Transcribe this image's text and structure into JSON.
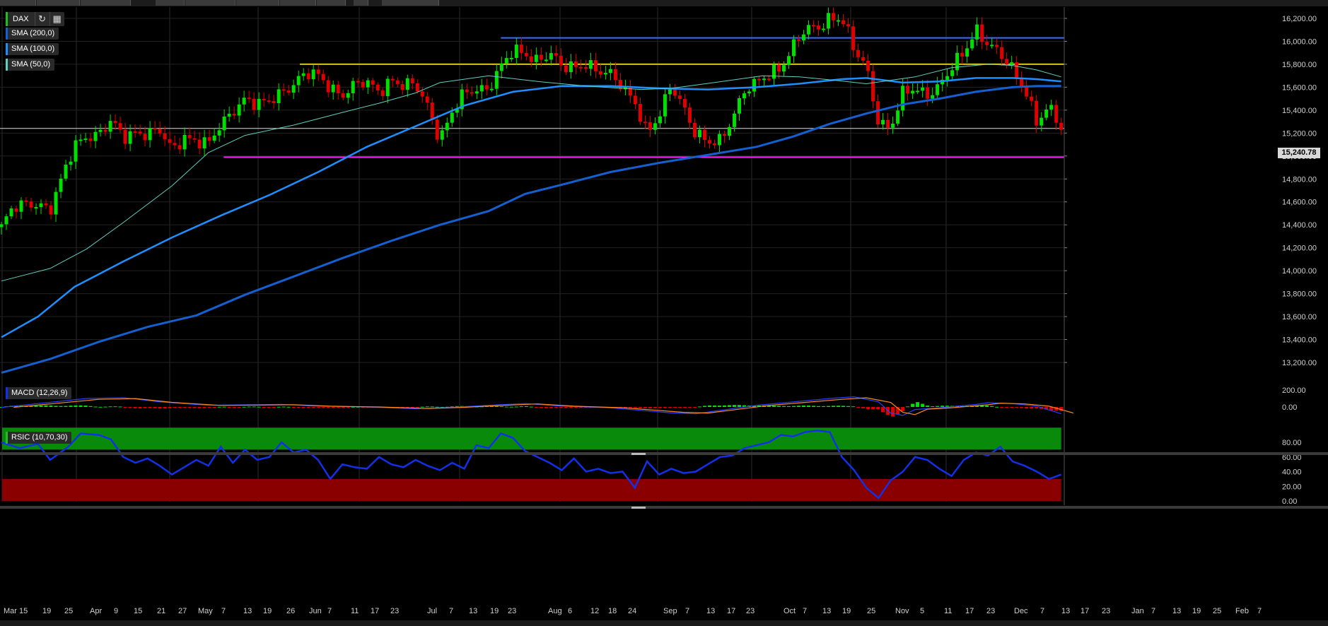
{
  "instrument": "DAX",
  "current_price_label": "15,240.78",
  "indicators": {
    "sma200": "SMA (200,0)",
    "sma100": "SMA (100,0)",
    "sma50": "SMA (50,0)",
    "macd": "MACD (12,26,9)",
    "rsic": "RSIC (10,70,30)"
  },
  "icons": {
    "refresh": "refresh-icon",
    "calendar": "calendar-icon"
  },
  "colors": {
    "up": "#00e000",
    "down": "#e00000",
    "sma50": "#5fd0c0",
    "sma100": "#1e8fff",
    "sma200": "#1560d0",
    "resistance_blue": "#3a6bff",
    "resistance_yellow": "#d7c41c",
    "support_magenta": "#ff20ff",
    "rsi_overbought_zone": "#0a8a0a",
    "rsi_oversold_zone": "#8a0000",
    "rsi_line": "#1230e8"
  },
  "chart_data": {
    "type": "candlestick",
    "price_axis": {
      "ylim": [
        13100,
        16300
      ],
      "ticks": [
        "16,200.00",
        "16,000.00",
        "15,800.00",
        "15,600.00",
        "15,400.00",
        "15,200.00",
        "15,000.00",
        "14,800.00",
        "14,600.00",
        "14,400.00",
        "14,200.00",
        "14,000.00",
        "13,800.00",
        "13,600.00",
        "13,400.00",
        "13,200.00"
      ]
    },
    "x_ticks": [
      "Mar 15",
      "19",
      "25",
      "Apr",
      "9",
      "15",
      "21",
      "27",
      "May",
      "7",
      "13",
      "19",
      "26",
      "Jun",
      "7",
      "11",
      "17",
      "23",
      "Jul",
      "7",
      "13",
      "19",
      "23",
      "Aug",
      "6",
      "12",
      "18",
      "24",
      "Sep",
      "7",
      "13",
      "17",
      "23",
      "Oct",
      "7",
      "13",
      "19",
      "25",
      "Nov",
      "5",
      "11",
      "17",
      "23",
      "Dec",
      "7",
      "13",
      "17",
      "23",
      "Jan",
      "7",
      "13",
      "19",
      "25",
      "Feb",
      "7"
    ],
    "horizontal_lines": [
      {
        "level": 16030,
        "color": "blue"
      },
      {
        "level": 15800,
        "color": "yellow"
      },
      {
        "level": 14990,
        "color": "magenta"
      },
      {
        "level": 15240.78,
        "color": "white"
      }
    ],
    "sma50_anchors": [
      [
        0,
        13910
      ],
      [
        80,
        14020
      ],
      [
        140,
        14190
      ],
      [
        200,
        14420
      ],
      [
        280,
        14740
      ],
      [
        340,
        15030
      ],
      [
        400,
        15180
      ],
      [
        480,
        15270
      ],
      [
        560,
        15380
      ],
      [
        620,
        15460
      ],
      [
        680,
        15550
      ],
      [
        720,
        15640
      ],
      [
        800,
        15700
      ],
      [
        880,
        15650
      ],
      [
        960,
        15610
      ],
      [
        1050,
        15580
      ],
      [
        1100,
        15590
      ],
      [
        1170,
        15640
      ],
      [
        1250,
        15700
      ],
      [
        1310,
        15690
      ],
      [
        1370,
        15660
      ],
      [
        1420,
        15630
      ],
      [
        1500,
        15690
      ],
      [
        1560,
        15770
      ],
      [
        1620,
        15800
      ],
      [
        1660,
        15790
      ],
      [
        1700,
        15750
      ],
      [
        1740,
        15690
      ]
    ],
    "sma100_anchors": [
      [
        0,
        13420
      ],
      [
        60,
        13600
      ],
      [
        120,
        13860
      ],
      [
        200,
        14080
      ],
      [
        280,
        14290
      ],
      [
        360,
        14480
      ],
      [
        440,
        14660
      ],
      [
        520,
        14860
      ],
      [
        600,
        15080
      ],
      [
        680,
        15260
      ],
      [
        760,
        15440
      ],
      [
        840,
        15560
      ],
      [
        920,
        15610
      ],
      [
        1000,
        15610
      ],
      [
        1080,
        15590
      ],
      [
        1160,
        15580
      ],
      [
        1240,
        15600
      ],
      [
        1310,
        15630
      ],
      [
        1380,
        15670
      ],
      [
        1420,
        15680
      ],
      [
        1480,
        15640
      ],
      [
        1540,
        15650
      ],
      [
        1600,
        15680
      ],
      [
        1660,
        15680
      ],
      [
        1700,
        15670
      ],
      [
        1740,
        15650
      ]
    ],
    "sma200_anchors": [
      [
        0,
        13110
      ],
      [
        80,
        13230
      ],
      [
        160,
        13380
      ],
      [
        240,
        13510
      ],
      [
        320,
        13610
      ],
      [
        400,
        13790
      ],
      [
        480,
        13950
      ],
      [
        560,
        14110
      ],
      [
        640,
        14260
      ],
      [
        720,
        14400
      ],
      [
        800,
        14520
      ],
      [
        860,
        14670
      ],
      [
        920,
        14750
      ],
      [
        1000,
        14860
      ],
      [
        1080,
        14940
      ],
      [
        1160,
        15010
      ],
      [
        1240,
        15080
      ],
      [
        1300,
        15170
      ],
      [
        1360,
        15280
      ],
      [
        1420,
        15370
      ],
      [
        1480,
        15450
      ],
      [
        1540,
        15500
      ],
      [
        1600,
        15560
      ],
      [
        1660,
        15600
      ],
      [
        1700,
        15610
      ],
      [
        1740,
        15610
      ]
    ],
    "candle_path": [
      [
        0,
        14380
      ],
      [
        20,
        14530
      ],
      [
        40,
        14580
      ],
      [
        60,
        14610
      ],
      [
        80,
        14530
      ],
      [
        100,
        14790
      ],
      [
        120,
        15090
      ],
      [
        140,
        15200
      ],
      [
        160,
        15190
      ],
      [
        180,
        15280
      ],
      [
        200,
        15160
      ],
      [
        220,
        15230
      ],
      [
        240,
        15200
      ],
      [
        260,
        15200
      ],
      [
        280,
        15040
      ],
      [
        300,
        15190
      ],
      [
        320,
        15140
      ],
      [
        340,
        15080
      ],
      [
        360,
        15260
      ],
      [
        380,
        15420
      ],
      [
        400,
        15510
      ],
      [
        420,
        15420
      ],
      [
        440,
        15470
      ],
      [
        460,
        15580
      ],
      [
        480,
        15640
      ],
      [
        500,
        15700
      ],
      [
        520,
        15690
      ],
      [
        540,
        15620
      ],
      [
        560,
        15540
      ],
      [
        580,
        15600
      ],
      [
        600,
        15630
      ],
      [
        620,
        15580
      ],
      [
        640,
        15680
      ],
      [
        660,
        15590
      ],
      [
        680,
        15610
      ],
      [
        700,
        15450
      ],
      [
        720,
        15160
      ],
      [
        740,
        15360
      ],
      [
        760,
        15530
      ],
      [
        780,
        15600
      ],
      [
        800,
        15610
      ],
      [
        820,
        15760
      ],
      [
        840,
        15900
      ],
      [
        860,
        15910
      ],
      [
        880,
        15850
      ],
      [
        900,
        15880
      ],
      [
        920,
        15760
      ],
      [
        940,
        15790
      ],
      [
        960,
        15830
      ],
      [
        980,
        15720
      ],
      [
        1000,
        15690
      ],
      [
        1020,
        15620
      ],
      [
        1040,
        15500
      ],
      [
        1060,
        15180
      ],
      [
        1080,
        15320
      ],
      [
        1100,
        15640
      ],
      [
        1120,
        15450
      ],
      [
        1140,
        15180
      ],
      [
        1160,
        15090
      ],
      [
        1180,
        15140
      ],
      [
        1200,
        15360
      ],
      [
        1220,
        15560
      ],
      [
        1240,
        15610
      ],
      [
        1260,
        15720
      ],
      [
        1280,
        15800
      ],
      [
        1300,
        15950
      ],
      [
        1320,
        16080
      ],
      [
        1340,
        16120
      ],
      [
        1360,
        16230
      ],
      [
        1380,
        16200
      ],
      [
        1400,
        15900
      ],
      [
        1420,
        15780
      ],
      [
        1440,
        15320
      ],
      [
        1460,
        15240
      ],
      [
        1480,
        15520
      ],
      [
        1500,
        15590
      ],
      [
        1520,
        15560
      ],
      [
        1540,
        15610
      ],
      [
        1560,
        15740
      ],
      [
        1580,
        15900
      ],
      [
        1600,
        16130
      ],
      [
        1620,
        15980
      ],
      [
        1640,
        15860
      ],
      [
        1660,
        15750
      ],
      [
        1680,
        15620
      ],
      [
        1700,
        15300
      ],
      [
        1720,
        15400
      ],
      [
        1740,
        15240
      ]
    ],
    "macd_path": [
      [
        0,
        -5
      ],
      [
        60,
        40
      ],
      [
        140,
        100
      ],
      [
        200,
        110
      ],
      [
        260,
        60
      ],
      [
        340,
        20
      ],
      [
        400,
        25
      ],
      [
        460,
        30
      ],
      [
        520,
        10
      ],
      [
        600,
        0
      ],
      [
        680,
        -20
      ],
      [
        740,
        -5
      ],
      [
        800,
        20
      ],
      [
        860,
        40
      ],
      [
        920,
        10
      ],
      [
        1000,
        -10
      ],
      [
        1050,
        -40
      ],
      [
        1100,
        -70
      ],
      [
        1140,
        -80
      ],
      [
        1180,
        -40
      ],
      [
        1240,
        20
      ],
      [
        1300,
        60
      ],
      [
        1360,
        100
      ],
      [
        1400,
        120
      ],
      [
        1440,
        60
      ],
      [
        1460,
        -70
      ],
      [
        1480,
        -100
      ],
      [
        1500,
        -30
      ],
      [
        1540,
        -10
      ],
      [
        1600,
        30
      ],
      [
        1620,
        50
      ],
      [
        1660,
        40
      ],
      [
        1700,
        10
      ],
      [
        1740,
        -80
      ]
    ],
    "rsi_path": [
      [
        0,
        80
      ],
      [
        30,
        72
      ],
      [
        60,
        78
      ],
      [
        80,
        56
      ],
      [
        110,
        74
      ],
      [
        130,
        92
      ],
      [
        160,
        90
      ],
      [
        180,
        84
      ],
      [
        200,
        60
      ],
      [
        220,
        52
      ],
      [
        240,
        58
      ],
      [
        260,
        48
      ],
      [
        280,
        36
      ],
      [
        300,
        46
      ],
      [
        320,
        56
      ],
      [
        340,
        48
      ],
      [
        360,
        74
      ],
      [
        380,
        52
      ],
      [
        400,
        70
      ],
      [
        420,
        56
      ],
      [
        440,
        60
      ],
      [
        460,
        80
      ],
      [
        480,
        66
      ],
      [
        500,
        70
      ],
      [
        520,
        56
      ],
      [
        540,
        30
      ],
      [
        560,
        50
      ],
      [
        580,
        46
      ],
      [
        600,
        44
      ],
      [
        620,
        60
      ],
      [
        640,
        50
      ],
      [
        660,
        46
      ],
      [
        680,
        56
      ],
      [
        700,
        48
      ],
      [
        720,
        42
      ],
      [
        740,
        52
      ],
      [
        760,
        44
      ],
      [
        780,
        76
      ],
      [
        800,
        72
      ],
      [
        820,
        92
      ],
      [
        840,
        86
      ],
      [
        860,
        68
      ],
      [
        880,
        60
      ],
      [
        900,
        52
      ],
      [
        920,
        42
      ],
      [
        940,
        58
      ],
      [
        960,
        40
      ],
      [
        980,
        44
      ],
      [
        1000,
        38
      ],
      [
        1020,
        40
      ],
      [
        1040,
        18
      ],
      [
        1060,
        54
      ],
      [
        1080,
        36
      ],
      [
        1100,
        44
      ],
      [
        1120,
        38
      ],
      [
        1140,
        40
      ],
      [
        1160,
        50
      ],
      [
        1180,
        60
      ],
      [
        1200,
        62
      ],
      [
        1220,
        72
      ],
      [
        1240,
        76
      ],
      [
        1260,
        80
      ],
      [
        1280,
        90
      ],
      [
        1300,
        88
      ],
      [
        1320,
        94
      ],
      [
        1340,
        96
      ],
      [
        1360,
        94
      ],
      [
        1380,
        60
      ],
      [
        1400,
        42
      ],
      [
        1420,
        18
      ],
      [
        1440,
        4
      ],
      [
        1460,
        28
      ],
      [
        1480,
        40
      ],
      [
        1500,
        60
      ],
      [
        1520,
        56
      ],
      [
        1540,
        44
      ],
      [
        1560,
        34
      ],
      [
        1580,
        56
      ],
      [
        1600,
        66
      ],
      [
        1620,
        62
      ],
      [
        1640,
        74
      ],
      [
        1660,
        54
      ],
      [
        1680,
        48
      ],
      [
        1700,
        40
      ],
      [
        1720,
        30
      ],
      [
        1740,
        36
      ]
    ],
    "rsi_axis_ticks": [
      "80.00",
      "60.00",
      "40.00",
      "20.00",
      "0.00"
    ],
    "macd_axis_ticks": [
      "200.00",
      "0.00"
    ]
  }
}
